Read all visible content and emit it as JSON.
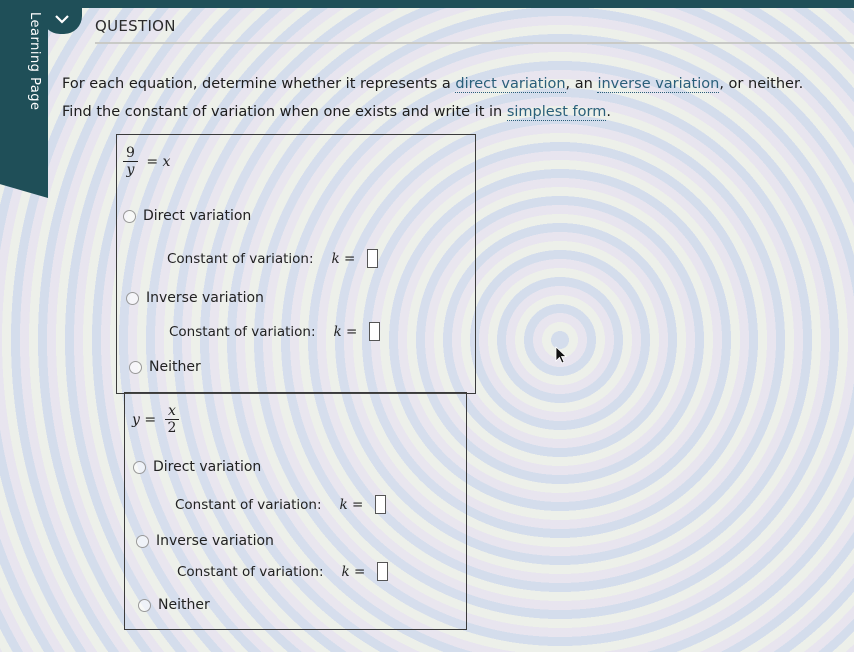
{
  "sidebar": {
    "label": "Learning Page"
  },
  "header": {
    "title": "QUESTION"
  },
  "instructions": {
    "line1_pre": "For each equation, determine whether it represents a ",
    "term_direct": "direct variation",
    "line1_mid": ", an ",
    "term_inverse": "inverse variation",
    "line1_post": ", or neither.",
    "line2_pre": "Find the constant of variation when one exists and write it in ",
    "term_simplest": "simplest form",
    "line2_post": "."
  },
  "problems": [
    {
      "equation": {
        "numerator": "9",
        "denominator": "y",
        "rhs": "= x"
      },
      "options": {
        "direct": "Direct variation",
        "inverse": "Inverse variation",
        "neither": "Neither"
      },
      "constant_label": "Constant of variation:",
      "k_label": "k =",
      "direct_k_value": "",
      "inverse_k_value": ""
    },
    {
      "equation": {
        "lhs": "y =",
        "numerator": "x",
        "denominator": "2"
      },
      "options": {
        "direct": "Direct variation",
        "inverse": "Inverse variation",
        "neither": "Neither"
      },
      "constant_label": "Constant of variation:",
      "k_label": "k =",
      "direct_k_value": "",
      "inverse_k_value": ""
    }
  ],
  "colors": {
    "sidebar": "#1f4f58",
    "link": "#2a5f7a"
  }
}
